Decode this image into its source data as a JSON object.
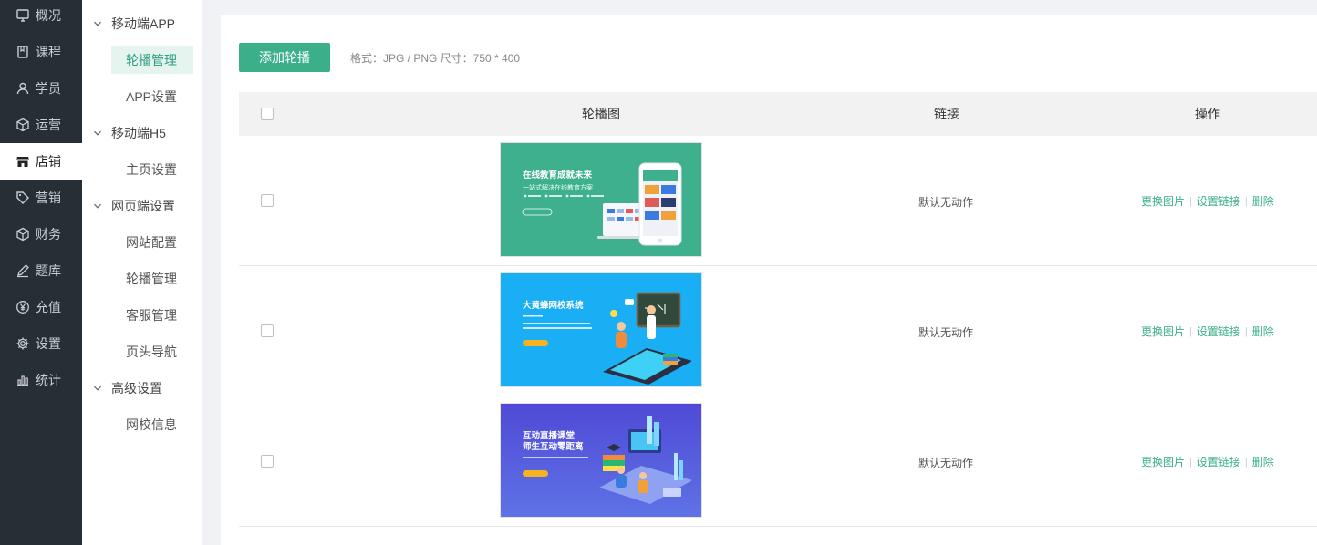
{
  "sidebar": {
    "items": [
      {
        "label": "概况",
        "icon": "monitor-icon"
      },
      {
        "label": "课程",
        "icon": "book-icon"
      },
      {
        "label": "学员",
        "icon": "user-icon"
      },
      {
        "label": "运营",
        "icon": "cube-icon"
      },
      {
        "label": "店铺",
        "icon": "store-icon",
        "active": true
      },
      {
        "label": "营销",
        "icon": "tag-icon"
      },
      {
        "label": "财务",
        "icon": "box-icon"
      },
      {
        "label": "题库",
        "icon": "pen-icon"
      },
      {
        "label": "充值",
        "icon": "yen-icon"
      },
      {
        "label": "设置",
        "icon": "gear-icon"
      },
      {
        "label": "统计",
        "icon": "bar-chart-icon"
      }
    ]
  },
  "submenu": {
    "groups": [
      {
        "label": "移动端APP",
        "items": [
          "轮播管理",
          "APP设置"
        ]
      },
      {
        "label": "移动端H5",
        "items": [
          "主页设置"
        ]
      },
      {
        "label": "网页端设置",
        "items": [
          "网站配置",
          "轮播管理",
          "客服管理",
          "页头导航"
        ]
      },
      {
        "label": "高级设置",
        "items": [
          "网校信息"
        ]
      }
    ],
    "active_item": "轮播管理"
  },
  "toolbar": {
    "add_label": "添加轮播",
    "format_hint": "格式：JPG / PNG 尺寸：750 * 400"
  },
  "table": {
    "headers": [
      "轮播图",
      "链接",
      "操作"
    ],
    "rows": [
      {
        "link": "默认无动作",
        "banner": {
          "line1": "在线教育成就未来",
          "line2": "一站式解决在线教育方案",
          "bg": "#3fb08d"
        }
      },
      {
        "link": "默认无动作",
        "banner": {
          "line1": "大黄蜂网校系统",
          "line2": "",
          "bg": "#1aaef5"
        }
      },
      {
        "link": "默认无动作",
        "banner": {
          "line1": "互动直播课堂",
          "line2": "师生互动零距离",
          "bg": "#4e4fd6"
        }
      }
    ],
    "actions": [
      "更换图片",
      "设置链接",
      "删除"
    ]
  },
  "colors": {
    "accent": "#3aaf8a",
    "sidebar_bg": "#262f35",
    "active_sub_bg": "#e6f4f0"
  }
}
